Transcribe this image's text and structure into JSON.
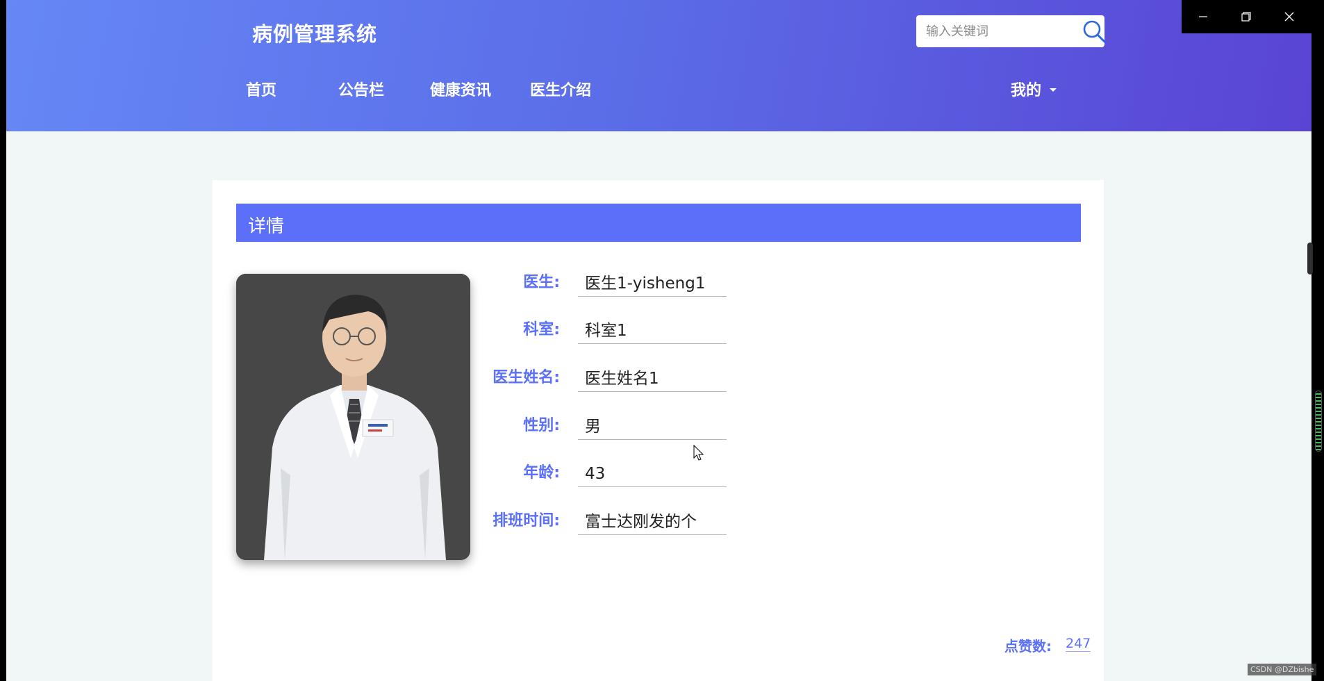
{
  "header": {
    "site_title": "病例管理系统",
    "search_placeholder": "输入关键词",
    "nav": {
      "home": "首页",
      "notice": "公告栏",
      "health": "健康资讯",
      "doctor_intro": "医生介绍",
      "my": "我的"
    }
  },
  "detail": {
    "title": "详情",
    "fields": [
      {
        "label": "医生:",
        "value": "医生1-yisheng1"
      },
      {
        "label": "科室:",
        "value": "科室1"
      },
      {
        "label": "医生姓名:",
        "value": "医生姓名1"
      },
      {
        "label": "性别:",
        "value": "男"
      },
      {
        "label": "年龄:",
        "value": "43"
      },
      {
        "label": "排班时间:",
        "value": "富士达刚发的个"
      }
    ],
    "likes_label": "点赞数:",
    "likes_value": "247"
  },
  "watermark": "CSDN @DZbishe",
  "colors": {
    "header_gradient_start": "#6687f6",
    "header_gradient_end": "#5a44d4",
    "accent": "#5b6ff8",
    "page_bg": "#f1f6f6"
  },
  "icons": [
    "search-icon",
    "caret-down-icon",
    "minimize-icon",
    "restore-icon",
    "close-icon",
    "cursor-icon"
  ]
}
